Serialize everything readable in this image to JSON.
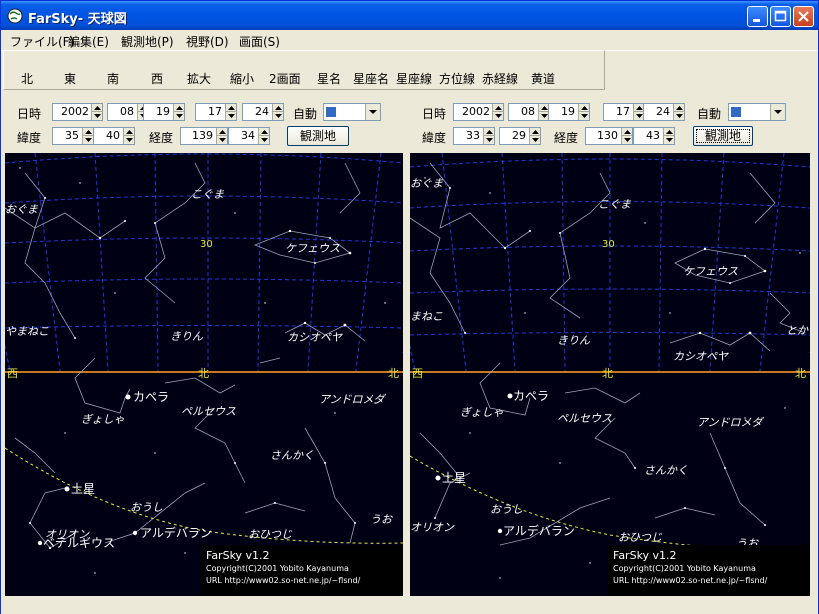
{
  "window": {
    "title": "FarSky- 天球図"
  },
  "menu": [
    "ファイル(F)",
    "編集(E)",
    "観測地(P)",
    "視野(D)",
    "画面(S)"
  ],
  "toolbar": [
    "北",
    "東",
    "南",
    "西",
    "拡大",
    "縮小",
    "2画面",
    "星名",
    "星座名",
    "星座線",
    "方位線",
    "赤経線",
    "黄道"
  ],
  "labels": {
    "datetime": "日時",
    "auto": "自動",
    "lat": "緯度",
    "lon": "経度",
    "observe": "観測地"
  },
  "panes": [
    {
      "date": {
        "year": "2002",
        "month": "08",
        "day": "19",
        "hour": "17",
        "minute": "24"
      },
      "lat": {
        "deg": "35",
        "min": "40"
      },
      "lon": {
        "deg": "139",
        "min": "34"
      },
      "sky": {
        "alt_label": "30",
        "horizon": {
          "left": "西",
          "center": "北",
          "right": "北"
        },
        "constellations": [
          "こぐま",
          "おぐま",
          "ケフェウス",
          "やまねこ",
          "きりん",
          "カシオペヤ",
          "ぎょしゃ",
          "ペルセウス",
          "アンドロメダ",
          "さんかく",
          "おうし",
          "オリオン",
          "おひつじ",
          "うお"
        ],
        "stars": [
          "カペラ",
          "土星",
          "アルデバラン",
          "ベテルギウス"
        ],
        "credit": {
          "title": "FarSky v1.2",
          "copyright": "Copyright(C)2001  Yobito Kayanuma",
          "url": "URL http://www02.so-net.ne.jp/~flsnd/"
        }
      }
    },
    {
      "date": {
        "year": "2002",
        "month": "08",
        "day": "19",
        "hour": "17",
        "minute": "24"
      },
      "lat": {
        "deg": "33",
        "min": "29"
      },
      "lon": {
        "deg": "130",
        "min": "43"
      },
      "sky": {
        "alt_label": "30",
        "horizon": {
          "left": "西",
          "center": "北",
          "right": "北"
        },
        "constellations": [
          "おぐま",
          "こぐま",
          "ケフェウス",
          "まねこ",
          "きりん",
          "カシオペヤ",
          "とか",
          "ぎょしゃ",
          "ペルセウス",
          "アンドロメダ",
          "さんかく",
          "おうし",
          "オリオン",
          "おひつじ",
          "うお"
        ],
        "stars": [
          "カペラ",
          "土星",
          "アルデバラン"
        ],
        "credit": {
          "title": "FarSky v1.2",
          "copyright": "Copyright(C)2001  Yobito Kayanuma",
          "url": "URL http://www02.so-net.ne.jp/~flsnd/"
        }
      }
    }
  ]
}
